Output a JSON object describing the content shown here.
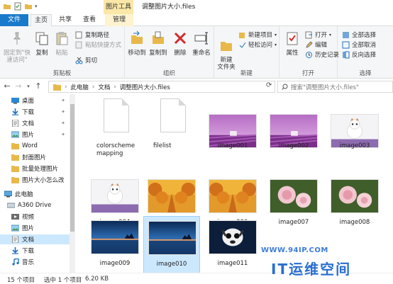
{
  "window": {
    "context_tab": "图片工具",
    "title": "调整图片大小.files"
  },
  "tabs": [
    "文件",
    "主页",
    "共享",
    "查看",
    "管理"
  ],
  "ribbon": {
    "clipboard": {
      "pin_label": "固定到\"快速访问\"",
      "copy": "复制",
      "paste": "粘贴",
      "copy_path": "复制路径",
      "paste_shortcut": "粘贴快捷方式",
      "cut": "剪切",
      "group": "剪贴板"
    },
    "organize": {
      "move_to": "移动到",
      "copy_to": "复制到",
      "delete": "删除",
      "rename": "重命名",
      "group": "组织"
    },
    "new": {
      "new_folder": "新建\n文件夹",
      "new_item": "新建项目",
      "easy_access": "轻松访问",
      "group": "新建"
    },
    "open": {
      "properties": "属性",
      "open": "打开",
      "edit": "编辑",
      "history": "历史记录",
      "group": "打开"
    },
    "select": {
      "select_all": "全部选择",
      "select_none": "全部取消",
      "invert": "反向选择",
      "group": "选择"
    }
  },
  "address": {
    "path": [
      "此电脑",
      "文档",
      "调整图片大小.files"
    ],
    "search_placeholder": "搜索\"调整图片大小.files\""
  },
  "nav": [
    {
      "label": "桌面",
      "icon": "desktop-icon",
      "pinned": true
    },
    {
      "label": "下载",
      "icon": "download-icon",
      "pinned": true
    },
    {
      "label": "文档",
      "icon": "document-icon",
      "pinned": true
    },
    {
      "label": "图片",
      "icon": "picture-icon",
      "pinned": true
    },
    {
      "label": "Word",
      "icon": "folder-icon",
      "pinned": false
    },
    {
      "label": "封面图片",
      "icon": "folder-icon",
      "pinned": false
    },
    {
      "label": "批量处理图片",
      "icon": "folder-icon",
      "pinned": false
    },
    {
      "label": "图片大小怎么改",
      "icon": "folder-icon",
      "pinned": false
    },
    {
      "label": "此电脑",
      "icon": "computer-icon",
      "pinned": false
    },
    {
      "label": "A360 Drive",
      "icon": "cloud-drive-icon",
      "pinned": false
    },
    {
      "label": "视频",
      "icon": "video-icon",
      "pinned": false
    },
    {
      "label": "图片",
      "icon": "picture-icon",
      "pinned": false
    },
    {
      "label": "文档",
      "icon": "document-icon",
      "pinned": false
    },
    {
      "label": "下载",
      "icon": "download-icon",
      "pinned": false
    },
    {
      "label": "音乐",
      "icon": "music-icon",
      "pinned": false
    }
  ],
  "files": [
    {
      "name": "colorschememapping",
      "kind": "doc"
    },
    {
      "name": "filelist",
      "kind": "doc"
    },
    {
      "name": "image001",
      "kind": "lavender"
    },
    {
      "name": "image002",
      "kind": "lavender"
    },
    {
      "name": "image003",
      "kind": "cat"
    },
    {
      "name": "image004",
      "kind": "cat"
    },
    {
      "name": "image005",
      "kind": "autumn"
    },
    {
      "name": "image006",
      "kind": "autumn"
    },
    {
      "name": "image007",
      "kind": "flower"
    },
    {
      "name": "image008",
      "kind": "flower"
    },
    {
      "name": "image009",
      "kind": "lake"
    },
    {
      "name": "image010",
      "kind": "lake",
      "selected": true
    },
    {
      "name": "image011",
      "kind": "dog"
    }
  ],
  "status": {
    "count": "15 个项目",
    "selection": "选中 1 个项目",
    "size": "6.20 KB"
  },
  "watermark": {
    "url": "WWW.94IP.COM",
    "logo": "IT运维空间"
  },
  "colors": {
    "accent": "#1979ca",
    "selection": "#cce8ff",
    "context_tab": "#fbe7a7"
  }
}
